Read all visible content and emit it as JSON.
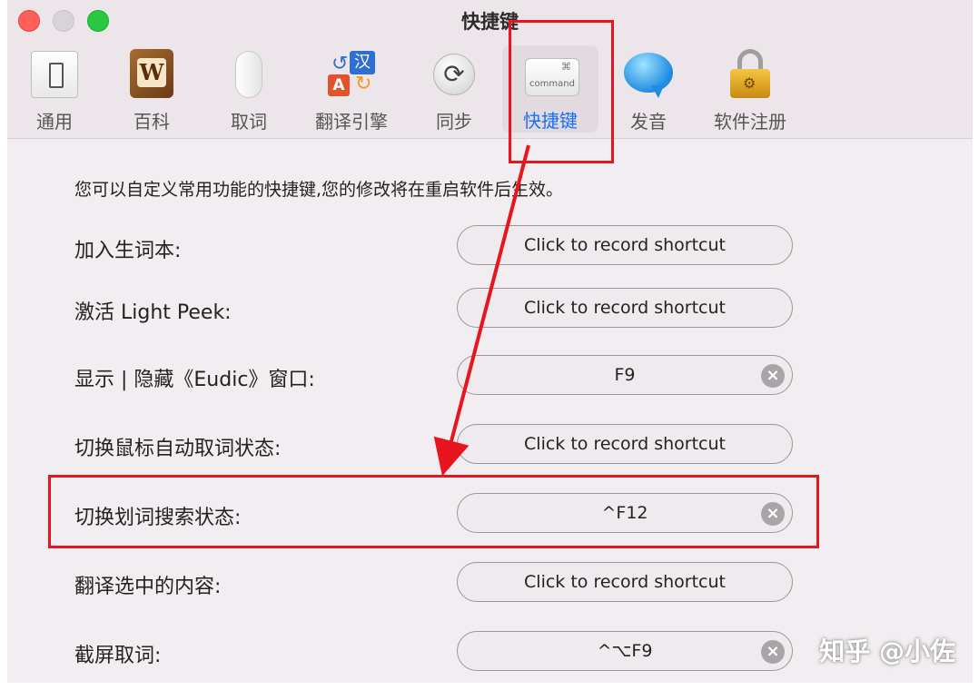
{
  "window": {
    "title": "快捷键"
  },
  "toolbar": {
    "items": [
      {
        "label": "通用",
        "icon": "general-switch-icon"
      },
      {
        "label": "百科",
        "icon": "wiki-book-icon"
      },
      {
        "label": "取词",
        "icon": "mouse-icon"
      },
      {
        "label": "翻译引擎",
        "icon": "translate-icon"
      },
      {
        "label": "同步",
        "icon": "sync-icon"
      },
      {
        "label": "快捷键",
        "icon": "command-key-icon",
        "active": true
      },
      {
        "label": "发音",
        "icon": "speech-bubble-icon"
      },
      {
        "label": "软件注册",
        "icon": "lock-icon"
      }
    ],
    "command_key_symbol": "⌘",
    "command_key_text": "command",
    "wiki_letter": "W",
    "translate_han": "汉",
    "translate_a": "A"
  },
  "content": {
    "intro": "您可以自定义常用功能的快捷键,您的修改将在重启软件后生效。",
    "rows": [
      {
        "label": "加入生词本:",
        "shortcut": "Click to record shortcut",
        "clearable": false
      },
      {
        "label": "激活 Light Peek:",
        "shortcut": "Click to record shortcut",
        "clearable": false
      },
      {
        "label": "显示 | 隐藏《Eudic》窗口:",
        "shortcut": "F9",
        "clearable": true
      },
      {
        "label": "切换鼠标自动取词状态:",
        "shortcut": "Click to record shortcut",
        "clearable": false
      },
      {
        "label": "切换划词搜索状态:",
        "shortcut": "^F12",
        "clearable": true
      },
      {
        "label": "翻译选中的内容:",
        "shortcut": "Click to record shortcut",
        "clearable": false
      },
      {
        "label": "截屏取词:",
        "shortcut": "^⌥F9",
        "clearable": true
      }
    ]
  },
  "annotation": {
    "color": "#e8141e"
  },
  "watermark": "知乎 @小佐"
}
